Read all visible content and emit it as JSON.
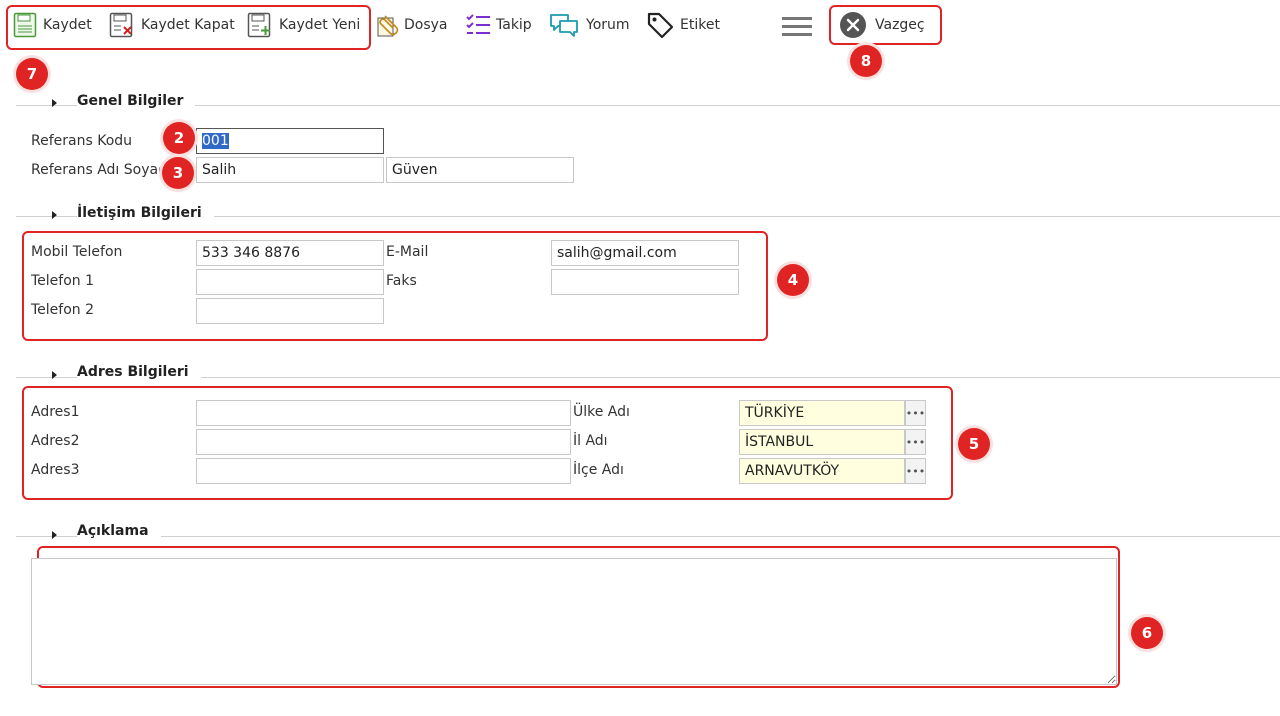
{
  "toolbar": {
    "save": "Kaydet",
    "save_close": "Kaydet Kapat",
    "save_new": "Kaydet Yeni",
    "file": "Dosya",
    "follow": "Takip",
    "comment": "Yorum",
    "tag": "Etiket",
    "cancel": "Vazgeç"
  },
  "badges": {
    "b7": "7",
    "b8": "8",
    "b2": "2",
    "b3": "3",
    "b4": "4",
    "b5": "5",
    "b6": "6"
  },
  "sections": {
    "general": "Genel Bilgiler",
    "contact": "İletişim Bilgileri",
    "address": "Adres Bilgileri",
    "description": "Açıklama"
  },
  "general": {
    "ref_code_label": "Referans Kodu",
    "ref_code_value": "001",
    "ref_name_label": "Referans Adı Soyadı",
    "first_name": "Salih",
    "last_name": "Güven"
  },
  "contact": {
    "mobile_label": "Mobil Telefon",
    "mobile_value": "533 346 8876",
    "phone1_label": "Telefon 1",
    "phone1_value": "",
    "phone2_label": "Telefon 2",
    "phone2_value": "",
    "email_label": "E-Mail",
    "email_value": "salih@gmail.com",
    "fax_label": "Faks",
    "fax_value": ""
  },
  "address": {
    "addr1_label": "Adres1",
    "addr2_label": "Adres2",
    "addr3_label": "Adres3",
    "addr1_value": "",
    "addr2_value": "",
    "addr3_value": "",
    "country_label": "Ülke Adı",
    "country_value": "TÜRKİYE",
    "city_label": "İl Adı",
    "city_value": "İSTANBUL",
    "district_label": "İlçe Adı",
    "district_value": "ARNAVUTKÖY",
    "lookup_glyph": "•••"
  },
  "colors": {
    "highlight": "#e02424",
    "readonly_bg": "#ffffe0",
    "selection": "#3169c6"
  }
}
